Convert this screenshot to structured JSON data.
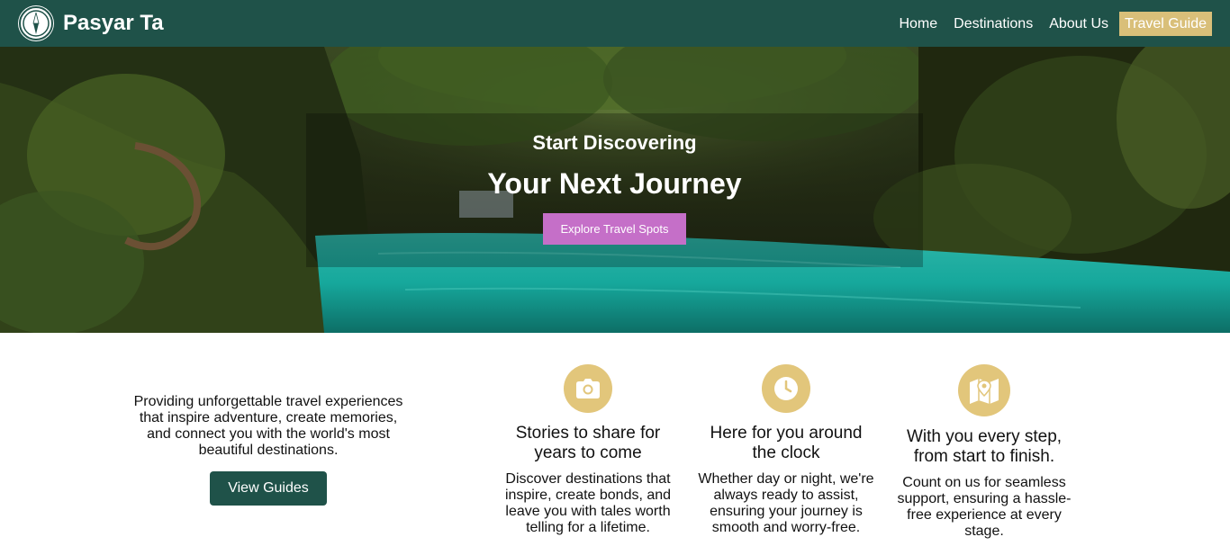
{
  "header": {
    "brand": "Pasyar Ta",
    "nav": [
      {
        "label": "Home"
      },
      {
        "label": "Destinations"
      },
      {
        "label": "About Us"
      },
      {
        "label": "Travel Guide",
        "active": true
      }
    ]
  },
  "hero": {
    "subtitle": "Start Discovering",
    "title": "Your Next Journey",
    "button": "Explore Travel Spots"
  },
  "intro": {
    "text": "Providing unforgettable travel experiences that inspire adventure, create memories, and connect you with the world's most beautiful destinations.",
    "button": "View Guides"
  },
  "features": [
    {
      "icon": "camera-icon",
      "title": "Stories to share for years to come",
      "text": "Discover destinations that inspire, create bonds, and leave you with tales worth telling for a lifetime."
    },
    {
      "icon": "clock-icon",
      "title": "Here for you around the clock",
      "text": "Whether day or night, we're always ready to assist, ensuring your journey is smooth and worry-free."
    },
    {
      "icon": "map-pin-icon",
      "title": "With you every step, from start to finish.",
      "text": "Count on us for seamless support, ensuring a hassle-free experience at every stage."
    }
  ],
  "colors": {
    "navbar": "#1f5249",
    "active_nav": "#d9bf79",
    "hero_button": "#c56fc8",
    "feature_icon_bg": "#e2c67b",
    "primary_button": "#1f5249"
  }
}
